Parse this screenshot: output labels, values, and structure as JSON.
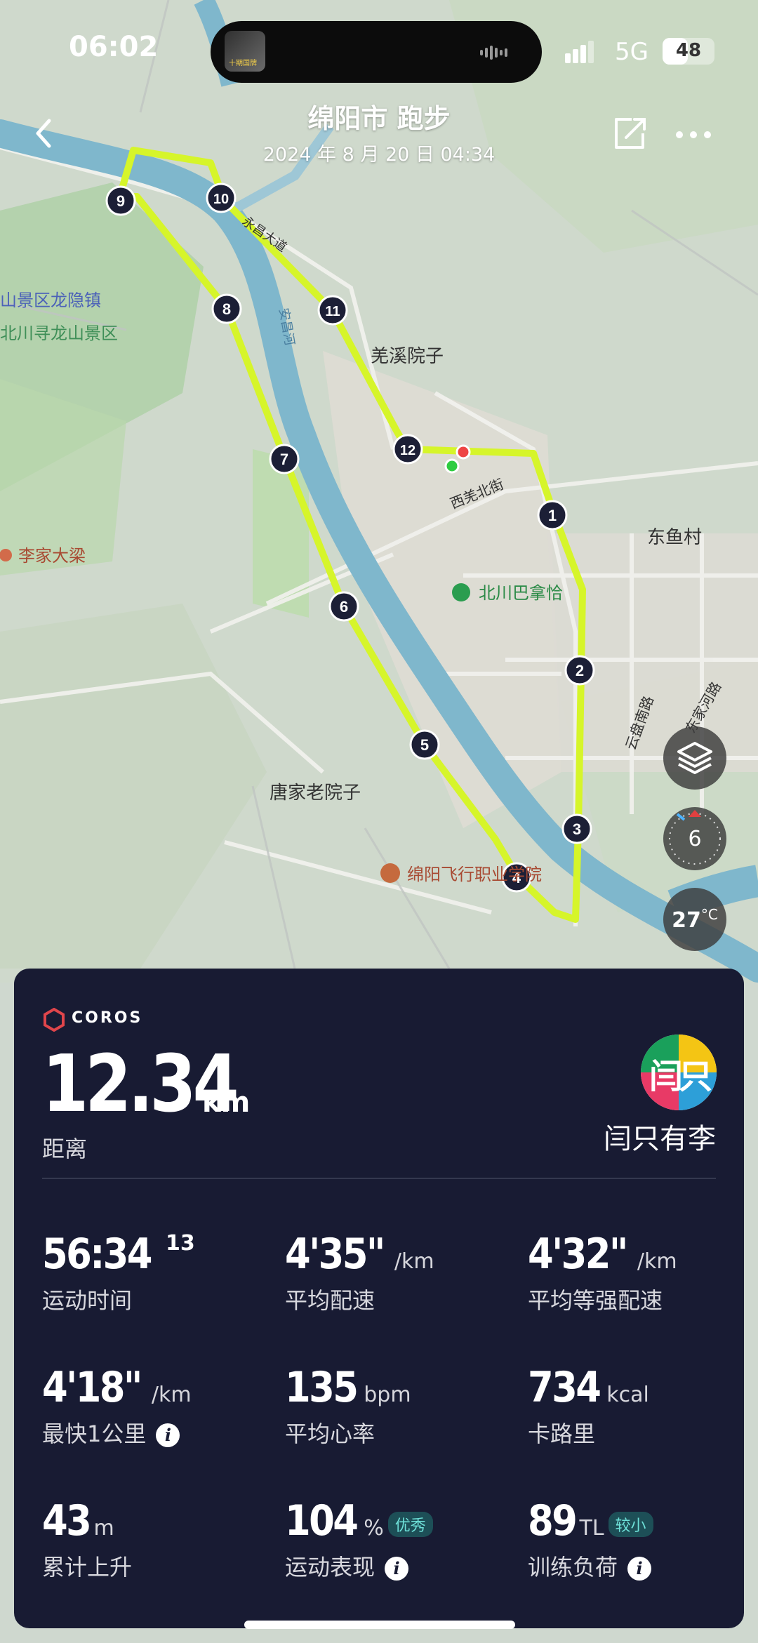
{
  "status_bar": {
    "time": "06:02",
    "network": "5G",
    "battery": "48",
    "battery_level": 0.48,
    "island_thumb_text": "十期国牌"
  },
  "header": {
    "title": "绵阳市 跑步",
    "subtitle": "2024 年 8 月 20 日 04:34"
  },
  "map": {
    "labels": {
      "longyin": "山景区龙隐镇",
      "xunlong": "北川寻龙山景区",
      "qiangxi": "羌溪院子",
      "xiqiang_st": "西羌北街",
      "dongyu": "东鱼村",
      "lijia": "李家大梁",
      "bachuan": "北川巴拿恰",
      "tangjia": "唐家老院子",
      "feixing": "绵阳飞行职业学院",
      "anchang_river": "安昌河",
      "yongchang_road": "永昌大道",
      "yunpan_road": "云盘南路",
      "dongjia_road": "东家河路"
    },
    "km_markers": [
      "1",
      "2",
      "3",
      "4",
      "5",
      "6",
      "7",
      "8",
      "9",
      "10",
      "11",
      "12"
    ],
    "route_color": "#d6f52a",
    "start_color": "#2ecc40",
    "end_color": "#ee4444"
  },
  "controls": {
    "compass_value": "6",
    "temperature": "27",
    "temperature_unit": "°C"
  },
  "card": {
    "brand": "COROS",
    "distance": "12.34",
    "distance_unit": "km",
    "distance_label": "距离",
    "avatar_text": "闫只有李",
    "user_name": "闫只有李",
    "stats": {
      "duration": {
        "value": "56:34",
        "sup": "13",
        "label": "运动时间"
      },
      "avg_pace": {
        "value": "4'35\"",
        "unit": "/km",
        "label": "平均配速"
      },
      "avg_eq_pace": {
        "value": "4'32\"",
        "unit": "/km",
        "label": "平均等强配速"
      },
      "fastest_km": {
        "value": "4'18\"",
        "unit": "/km",
        "label": "最快1公里"
      },
      "avg_hr": {
        "value": "135",
        "unit": "bpm",
        "label": "平均心率"
      },
      "calories": {
        "value": "734",
        "unit": "kcal",
        "label": "卡路里"
      },
      "ascent": {
        "value": "43",
        "unit": "m",
        "label": "累计上升"
      },
      "performance": {
        "value": "104",
        "unit": "%",
        "badge": "优秀",
        "label": "运动表现"
      },
      "training_load": {
        "value": "89",
        "unit": "TL",
        "badge": "较小",
        "label": "训练负荷"
      }
    }
  }
}
